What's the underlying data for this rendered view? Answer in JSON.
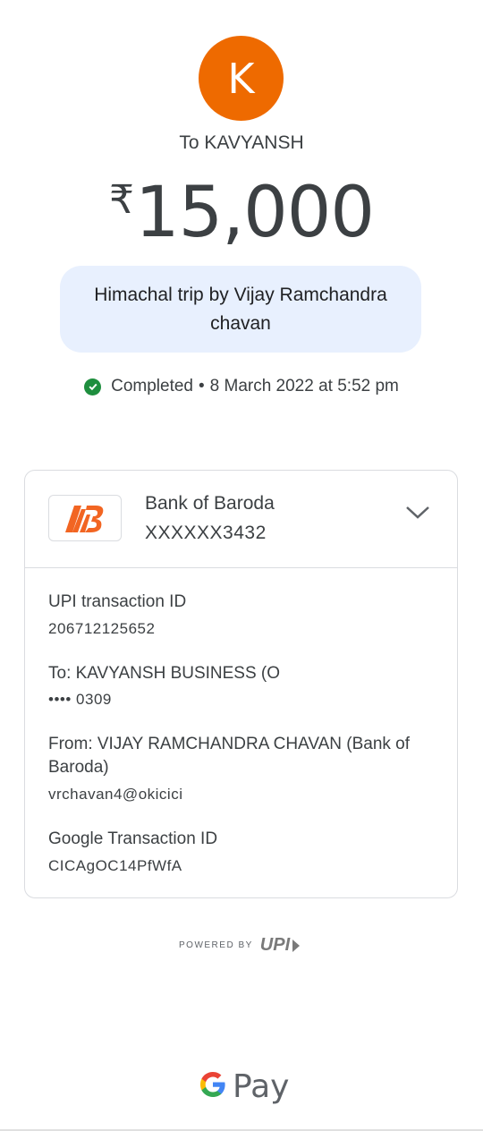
{
  "recipient": {
    "initial": "K",
    "to_label": "To KAVYANSH"
  },
  "payment": {
    "currency_symbol": "₹",
    "amount": "15,000",
    "note": "Himachal trip by Vijay Ramchandra chavan",
    "status": "Completed",
    "separator": "•",
    "datetime": "8 March 2022 at 5:52 pm"
  },
  "bank": {
    "name": "Bank of Baroda",
    "account": "XXXXXX3432"
  },
  "details": {
    "upi_label": "UPI transaction ID",
    "upi_value": "206712125652",
    "to_label": "To: KAVYANSH BUSINESS (O",
    "to_value": "•••• 0309",
    "from_label": "From: VIJAY RAMCHANDRA CHAVAN (Bank of Baroda)",
    "from_value": "vrchavan4@okicici",
    "google_label": "Google Transaction ID",
    "google_value": "CICAgOC14PfWfA"
  },
  "footer": {
    "powered_by": "POWERED BY",
    "upi_logo_text": "UPI",
    "brand_pay": "Pay"
  },
  "colors": {
    "avatar": "#ee6a00",
    "note_bg": "#e8f0fe",
    "success": "#1e8e3e",
    "bank_orange": "#f26522"
  },
  "icons": [
    "check-circle-icon",
    "bank-of-baroda-logo",
    "chevron-down-icon",
    "upi-logo",
    "google-g-logo"
  ]
}
